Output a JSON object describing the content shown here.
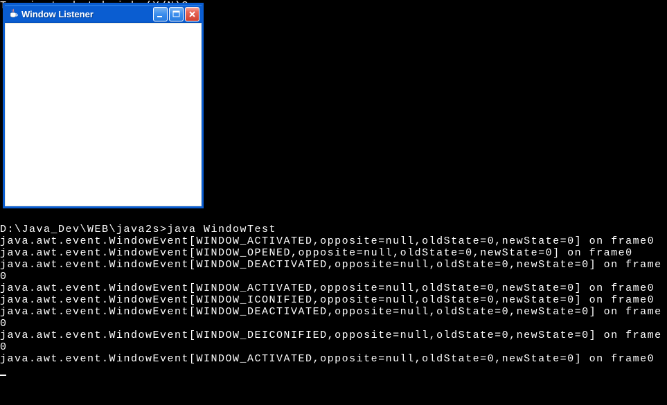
{
  "terminal_top_line": "Terminate batch job (Y/N)? n",
  "window": {
    "title": "Window Listener",
    "icon": "java-coffee-icon"
  },
  "terminal": {
    "prompt": "D:\\Java_Dev\\WEB\\java2s>java WindowTest",
    "lines": [
      "java.awt.event.WindowEvent[WINDOW_ACTIVATED,opposite=null,oldState=0,newState=0] on frame0",
      "java.awt.event.WindowEvent[WINDOW_OPENED,opposite=null,oldState=0,newState=0] on frame0",
      "java.awt.event.WindowEvent[WINDOW_DEACTIVATED,opposite=null,oldState=0,newState=0] on frame0",
      "java.awt.event.WindowEvent[WINDOW_ACTIVATED,opposite=null,oldState=0,newState=0] on frame0",
      "java.awt.event.WindowEvent[WINDOW_ICONIFIED,opposite=null,oldState=0,newState=0] on frame0",
      "java.awt.event.WindowEvent[WINDOW_DEACTIVATED,opposite=null,oldState=0,newState=0] on frame0",
      "java.awt.event.WindowEvent[WINDOW_DEICONIFIED,opposite=null,oldState=0,newState=0] on frame0",
      "java.awt.event.WindowEvent[WINDOW_ACTIVATED,opposite=null,oldState=0,newState=0] on frame0"
    ]
  }
}
